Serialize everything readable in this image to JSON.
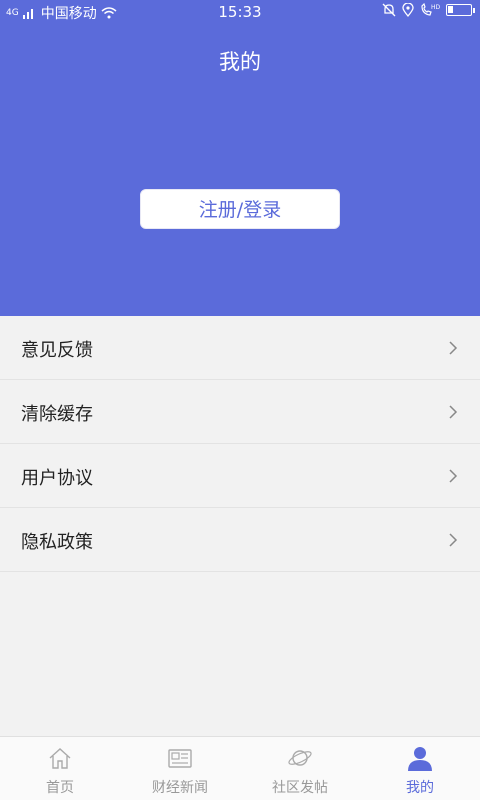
{
  "status_bar": {
    "carrier": "中国移动",
    "signal": "4G",
    "time": "15:33"
  },
  "page": {
    "title": "我的"
  },
  "login_button": {
    "label": "注册/登录"
  },
  "menu": [
    {
      "label": "意见反馈"
    },
    {
      "label": "清除缓存"
    },
    {
      "label": "用户协议"
    },
    {
      "label": "隐私政策"
    }
  ],
  "tabs": [
    {
      "label": "首页",
      "icon": "home-icon",
      "active": false
    },
    {
      "label": "财经新闻",
      "icon": "news-icon",
      "active": false
    },
    {
      "label": "社区发帖",
      "icon": "planet-icon",
      "active": false
    },
    {
      "label": "我的",
      "icon": "user-icon",
      "active": true
    }
  ],
  "colors": {
    "accent": "#5b6bda",
    "background": "#f2f2f2",
    "inactive_tab": "#999999"
  }
}
